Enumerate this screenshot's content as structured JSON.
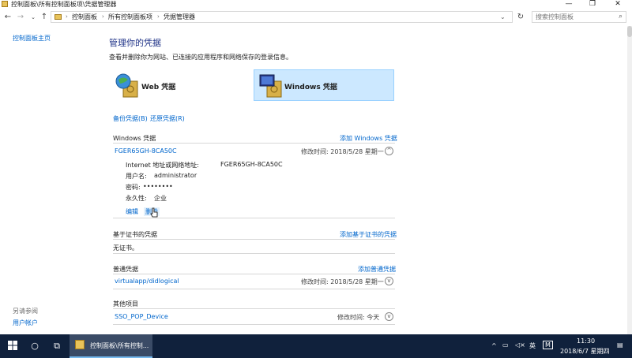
{
  "window": {
    "title": "控制面板\\所有控制面板项\\凭据管理器",
    "minimize": "—",
    "maximize": "❐",
    "close": "✕"
  },
  "address": {
    "crumbs": [
      "控制面板",
      "所有控制面板项",
      "凭据管理器"
    ],
    "search_placeholder": "搜索控制面板"
  },
  "leftnav": {
    "home": "控制面板主页",
    "see_also": "另请参阅",
    "user_accounts": "用户帐户"
  },
  "header": {
    "title": "管理你的凭据",
    "subtitle": "查看并删除你为网站、已连接的应用程序和网络保存的登录信息。"
  },
  "cards": {
    "web": "Web 凭据",
    "windows": "Windows 凭据"
  },
  "actions": {
    "backup": "备份凭据(B)",
    "restore": "还原凭据(R)"
  },
  "windows_section": {
    "title": "Windows 凭据",
    "add": "添加 Windows 凭据",
    "item": {
      "name": "FGER65GH-8CA50C",
      "modified": "修改时间:  2018/5/28 星期一",
      "detail": {
        "addr_label": "Internet 地址或网络地址:",
        "addr_value": "FGER65GH-8CA50C",
        "user_label": "用户名:",
        "user_value": "administrator",
        "pw_label": "密码:",
        "pw_value": "••••••••",
        "persist_label": "永久性:",
        "persist_value": "企业"
      },
      "edit": "编辑",
      "delete": "删除"
    }
  },
  "cert_section": {
    "title": "基于证书的凭据",
    "add": "添加基于证书的凭据",
    "empty": "无证书。"
  },
  "generic_section": {
    "title": "普通凭据",
    "add": "添加普通凭据",
    "item": {
      "name": "virtualapp/didlogical",
      "modified": "修改时间:  2018/5/28 星期一"
    }
  },
  "other_section": {
    "title": "其他项目",
    "item": {
      "name": "SSO_POP_Device",
      "modified": "修改时间:  今天"
    }
  },
  "taskbar": {
    "app_label": "控制面板\\所有控制...",
    "time": "11:30",
    "date": "2018/6/7 星期四",
    "lang": "英",
    "ime": "M"
  },
  "colors": {
    "link": "#0066cc",
    "selected_card": "#cce8ff",
    "taskbar": "#10213c"
  }
}
